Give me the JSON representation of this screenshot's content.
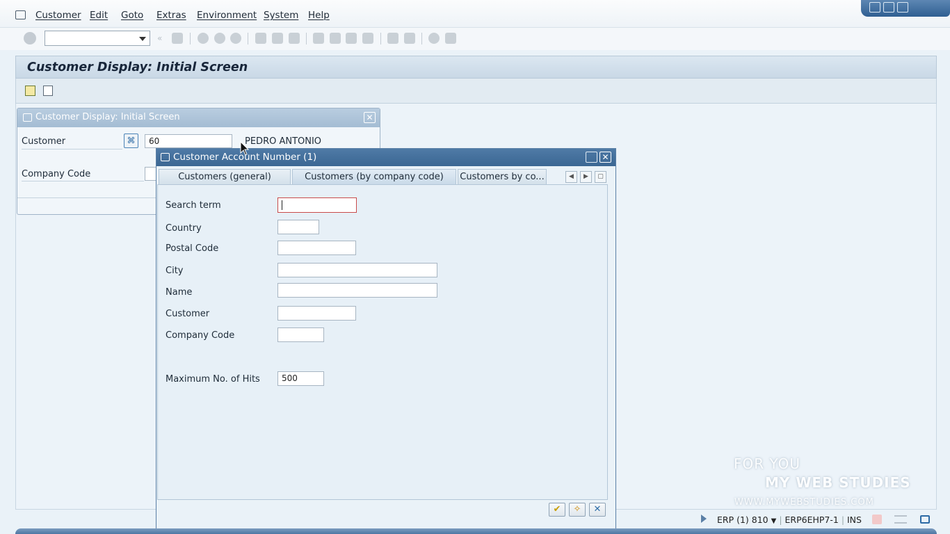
{
  "menu": {
    "items": [
      "Customer",
      "Edit",
      "Goto",
      "Extras",
      "Environment",
      "System",
      "Help"
    ]
  },
  "toolbar": {
    "command_field_value": ""
  },
  "screen": {
    "title": "Customer Display: Initial Screen"
  },
  "bg_dialog": {
    "title": "Customer Display: Initial Screen",
    "customer_label": "Customer",
    "customer_value": "60",
    "customer_name": "PEDRO ANTONIO",
    "company_code_label": "Company Code",
    "close_glyph": "✕"
  },
  "dialog": {
    "title": "Customer Account Number (1)",
    "tabs": [
      {
        "label": "Customers (general)"
      },
      {
        "label": "Customers (by company code)",
        "active": true
      },
      {
        "label": "Customers by co..."
      }
    ],
    "fields": [
      {
        "label": "Search term",
        "value": ""
      },
      {
        "label": "Country",
        "value": ""
      },
      {
        "label": "Postal Code",
        "value": ""
      },
      {
        "label": "City",
        "value": ""
      },
      {
        "label": "Name",
        "value": ""
      },
      {
        "label": "Customer",
        "value": ""
      },
      {
        "label": "Company Code",
        "value": ""
      },
      {
        "label": "Maximum No. of Hits",
        "value": "500"
      }
    ],
    "buttons": {
      "ok": "✔",
      "multi": "✧",
      "cancel": "✕"
    }
  },
  "status": {
    "system": "ERP (1) 810",
    "server": "ERP6EHP7-1",
    "mode": "INS"
  },
  "watermark": {
    "line1": "FOR YOU",
    "line2": "MY WEB STUDIES",
    "line3": "WWW.MYWEBSTUDIES.COM"
  },
  "colors": {
    "dialog_title_bg": "#3b6793",
    "screen_bg": "#eaf2f8",
    "accent_green": "#e4b800"
  }
}
